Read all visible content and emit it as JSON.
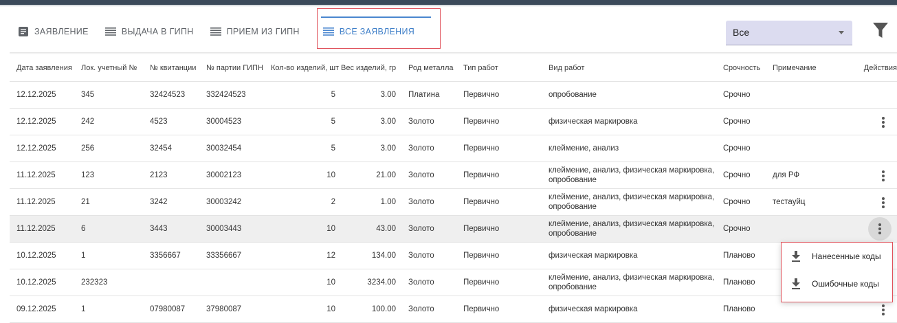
{
  "tabs": [
    {
      "label": "ЗАЯВЛЕНИЕ",
      "icon": "document-icon"
    },
    {
      "label": "ВЫДАЧА В ГИПН",
      "icon": "list-icon"
    },
    {
      "label": "ПРИЕМ ИЗ ГИПН",
      "icon": "list-icon"
    },
    {
      "label": "ВСЕ ЗАЯВЛЕНИЯ",
      "icon": "list-icon",
      "active": true
    }
  ],
  "filter_select": {
    "value": "Все"
  },
  "columns": [
    "Дата заявления",
    "Лок. учетный №",
    "№ квитанции",
    "№ партии ГИПН",
    "Кол-во изделий, шт",
    "Вес изделий, гр",
    "Род металла",
    "Тип работ",
    "Вид работ",
    "Срочность",
    "Примечание",
    "Действия"
  ],
  "rows": [
    [
      "12.12.2025",
      "345",
      "32424523",
      "332424523",
      "5",
      "3.00",
      "Платина",
      "Первично",
      "опробование",
      "Срочно",
      "",
      ""
    ],
    [
      "12.12.2025",
      "242",
      "4523",
      "30004523",
      "5",
      "3.00",
      "Золото",
      "Первично",
      "физическая маркировка",
      "Срочно",
      "",
      "menu"
    ],
    [
      "12.12.2025",
      "256",
      "32454",
      "30032454",
      "5",
      "3.00",
      "Золото",
      "Первично",
      "клеймение, анализ",
      "Срочно",
      "",
      ""
    ],
    [
      "11.12.2025",
      "123",
      "2123",
      "30002123",
      "10",
      "21.00",
      "Золото",
      "Первично",
      "клеймение, анализ, физическая маркировка, опробование",
      "Срочно",
      "для РФ",
      "menu"
    ],
    [
      "11.12.2025",
      "21",
      "3242",
      "30003242",
      "2",
      "1.00",
      "Золото",
      "Первично",
      "клеймение, анализ, физическая маркировка, опробование",
      "Срочно",
      "тестауйц",
      "menu"
    ],
    [
      "11.12.2025",
      "6",
      "3443",
      "30003443",
      "10",
      "43.00",
      "Золото",
      "Первично",
      "клеймение, анализ, физическая маркировка, опробование",
      "Срочно",
      "",
      "menu"
    ],
    [
      "10.12.2025",
      "1",
      "3356667",
      "33356667",
      "12",
      "134.00",
      "Золото",
      "Первично",
      "физическая маркировка",
      "Планово",
      "",
      ""
    ],
    [
      "10.12.2025",
      "232323",
      "",
      "",
      "10",
      "3234.00",
      "Золото",
      "Первично",
      "клеймение, анализ, физическая маркировка, опробование",
      "Планово",
      "",
      ""
    ],
    [
      "09.12.2025",
      "1",
      "07980087",
      "37980087",
      "10",
      "100.00",
      "Золото",
      "Первично",
      "физическая маркировка",
      "Планово",
      "",
      "menu"
    ]
  ],
  "context_menu": {
    "items": [
      "Нанесенные коды",
      "Ошибочные коды"
    ]
  }
}
